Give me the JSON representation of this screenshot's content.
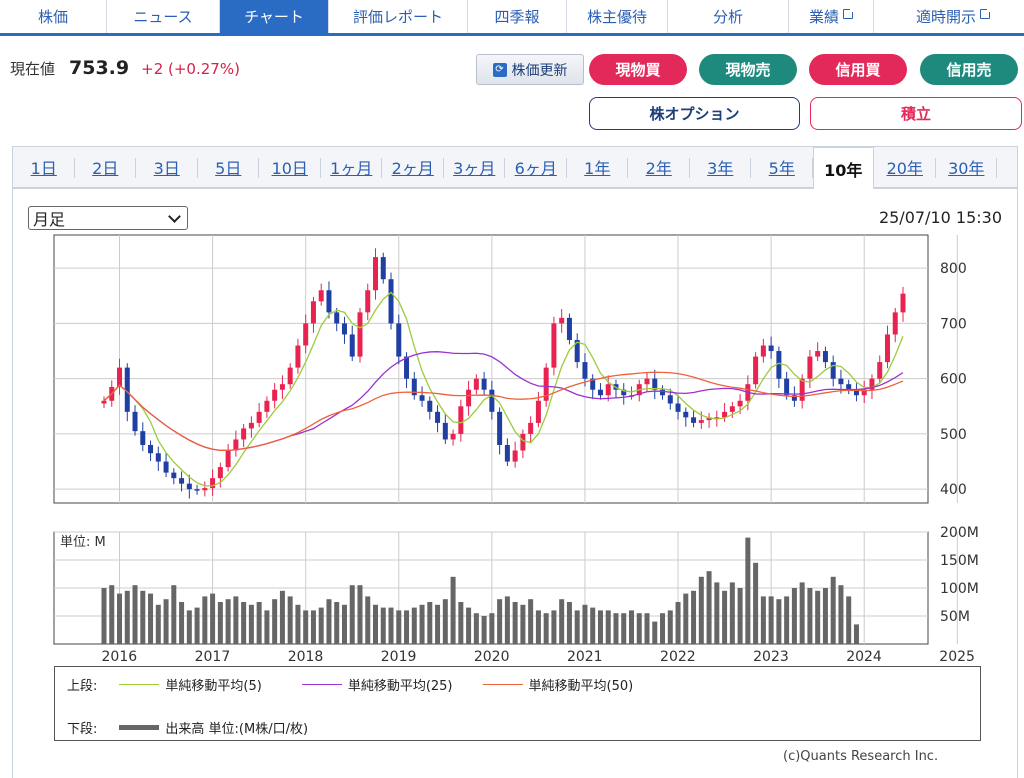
{
  "nav": {
    "tabs": [
      {
        "label": "株価",
        "active": false,
        "external": false
      },
      {
        "label": "ニュース",
        "active": false,
        "external": false
      },
      {
        "label": "チャート",
        "active": true,
        "external": false
      },
      {
        "label": "評価レポート",
        "active": false,
        "external": false
      },
      {
        "label": "四季報",
        "active": false,
        "external": false
      },
      {
        "label": "株主優待",
        "active": false,
        "external": false
      },
      {
        "label": "分析",
        "active": false,
        "external": false
      },
      {
        "label": "業績",
        "active": false,
        "external": true
      },
      {
        "label": "適時開示",
        "active": false,
        "external": true
      }
    ]
  },
  "quote": {
    "label": "現在値",
    "price": "753.9",
    "change": "+2 (+0.27%)",
    "refresh_label": "株価更新"
  },
  "actions": {
    "buy_cash": "現物買",
    "sell_cash": "現物売",
    "buy_margin": "信用買",
    "sell_margin": "信用売",
    "options": "株オプション",
    "accumulate": "積立"
  },
  "ranges": [
    "1日",
    "2日",
    "3日",
    "5日",
    "10日",
    "1ヶ月",
    "2ヶ月",
    "3ヶ月",
    "6ヶ月",
    "1年",
    "2年",
    "3年",
    "5年",
    "10年",
    "20年",
    "30年"
  ],
  "active_range": "10年",
  "period_select": "月足",
  "timestamp": "25/07/10 15:30",
  "colors": {
    "up": "#e8234f",
    "down": "#1f3fa3",
    "ma5": "#9ccc3c",
    "ma25": "#9a32d0",
    "ma50": "#f0603a",
    "volume": "#666666"
  },
  "chart_data": {
    "type": "candlestick",
    "price_ticks": [
      "800",
      "700",
      "600",
      "500",
      "400"
    ],
    "ylim": [
      375,
      860
    ],
    "volume_unit_label": "単位: M",
    "volume_ticks": [
      "200M",
      "150M",
      "100M",
      "50M"
    ],
    "volume_ylim": [
      0,
      200
    ],
    "year_labels": [
      "2016",
      "2017",
      "2018",
      "2019",
      "2020",
      "2021",
      "2022",
      "2023",
      "2024",
      "2025"
    ],
    "monthly_close": [
      560,
      585,
      620,
      540,
      505,
      480,
      465,
      450,
      430,
      420,
      410,
      400,
      398,
      402,
      420,
      440,
      470,
      490,
      510,
      520,
      540,
      560,
      580,
      590,
      620,
      660,
      700,
      740,
      760,
      720,
      700,
      680,
      640,
      720,
      760,
      820,
      780,
      700,
      640,
      600,
      570,
      560,
      540,
      520,
      490,
      500,
      550,
      580,
      600,
      580,
      540,
      480,
      450,
      470,
      500,
      520,
      560,
      620,
      700,
      710,
      670,
      630,
      600,
      580,
      570,
      590,
      580,
      570,
      570,
      590,
      600,
      580,
      570,
      555,
      540,
      530,
      520,
      525,
      530,
      530,
      540,
      550,
      560,
      590,
      640,
      660,
      650,
      600,
      570,
      560,
      600,
      640,
      650,
      630,
      600,
      590,
      580,
      570,
      580,
      600,
      630,
      680,
      720,
      753.9
    ],
    "volume": [
      100,
      105,
      90,
      95,
      105,
      95,
      90,
      70,
      80,
      105,
      75,
      60,
      65,
      85,
      90,
      75,
      80,
      85,
      75,
      70,
      75,
      60,
      80,
      95,
      85,
      70,
      60,
      60,
      65,
      80,
      75,
      70,
      105,
      105,
      85,
      70,
      65,
      65,
      60,
      60,
      65,
      70,
      75,
      70,
      80,
      120,
      75,
      65,
      55,
      50,
      55,
      80,
      85,
      75,
      70,
      80,
      60,
      55,
      60,
      80,
      75,
      60,
      70,
      65,
      60,
      60,
      55,
      55,
      60,
      55,
      55,
      40,
      55,
      60,
      75,
      90,
      95,
      120,
      130,
      110,
      95,
      110,
      100,
      190,
      145,
      85,
      85,
      80,
      85,
      100,
      110,
      100,
      95,
      100,
      120,
      105,
      85,
      35
    ],
    "ma5_label": "単純移動平均(5)",
    "ma25_label": "単純移動平均(25)",
    "ma50_label": "単純移動平均(50)",
    "volume_legend_label": "出来高 単位:(M株/口/枚)",
    "upper_label": "上段:",
    "lower_label": "下段:"
  },
  "copyright": "(c)Quants Research Inc."
}
